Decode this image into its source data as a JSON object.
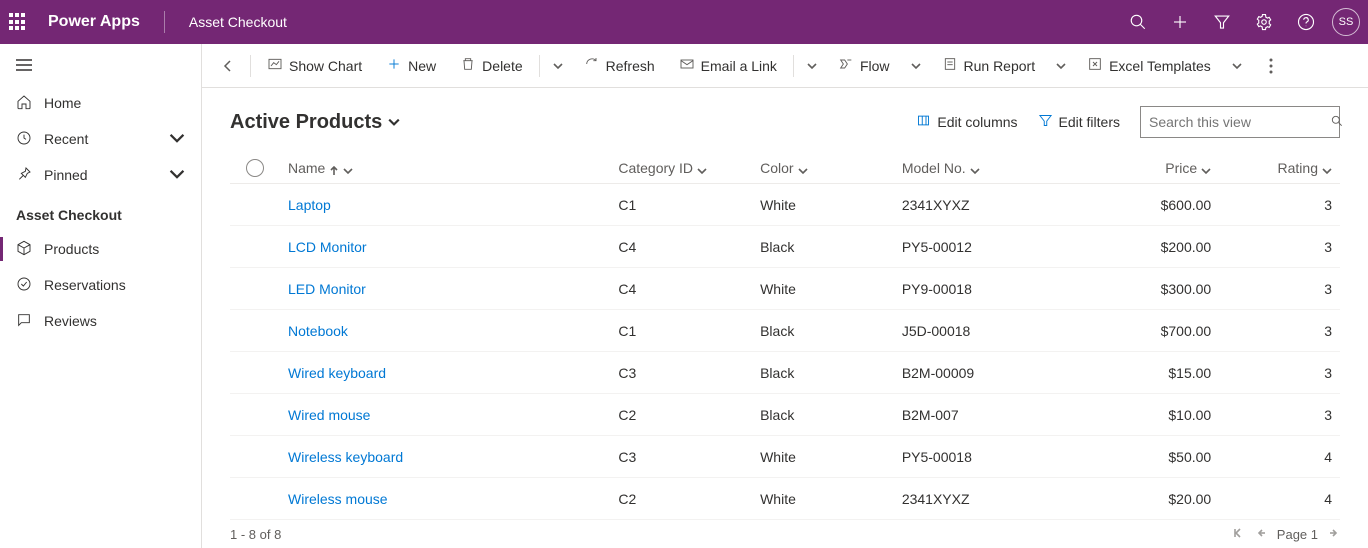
{
  "header": {
    "app_title": "Power Apps",
    "app_subtitle": "Asset Checkout",
    "avatar_initials": "SS"
  },
  "sidebar": {
    "nav": [
      {
        "label": "Home"
      },
      {
        "label": "Recent"
      },
      {
        "label": "Pinned"
      }
    ],
    "section_label": "Asset Checkout",
    "section_items": [
      {
        "label": "Products"
      },
      {
        "label": "Reservations"
      },
      {
        "label": "Reviews"
      }
    ]
  },
  "commandbar": {
    "show_chart": "Show Chart",
    "new": "New",
    "delete": "Delete",
    "refresh": "Refresh",
    "email_link": "Email a Link",
    "flow": "Flow",
    "run_report": "Run Report",
    "excel_templates": "Excel Templates"
  },
  "view": {
    "title": "Active Products",
    "edit_columns": "Edit columns",
    "edit_filters": "Edit filters",
    "search_placeholder": "Search this view"
  },
  "grid": {
    "columns": {
      "name": "Name",
      "category": "Category ID",
      "color": "Color",
      "model": "Model No.",
      "price": "Price",
      "rating": "Rating"
    },
    "rows": [
      {
        "name": "Laptop",
        "category": "C1",
        "color": "White",
        "model": "2341XYXZ",
        "price": "$600.00",
        "rating": "3"
      },
      {
        "name": "LCD Monitor",
        "category": "C4",
        "color": "Black",
        "model": "PY5-00012",
        "price": "$200.00",
        "rating": "3"
      },
      {
        "name": "LED Monitor",
        "category": "C4",
        "color": "White",
        "model": "PY9-00018",
        "price": "$300.00",
        "rating": "3"
      },
      {
        "name": "Notebook",
        "category": "C1",
        "color": "Black",
        "model": "J5D-00018",
        "price": "$700.00",
        "rating": "3"
      },
      {
        "name": "Wired keyboard",
        "category": "C3",
        "color": "Black",
        "model": "B2M-00009",
        "price": "$15.00",
        "rating": "3"
      },
      {
        "name": "Wired mouse",
        "category": "C2",
        "color": "Black",
        "model": "B2M-007",
        "price": "$10.00",
        "rating": "3"
      },
      {
        "name": "Wireless keyboard",
        "category": "C3",
        "color": "White",
        "model": "PY5-00018",
        "price": "$50.00",
        "rating": "4"
      },
      {
        "name": "Wireless mouse",
        "category": "C2",
        "color": "White",
        "model": "2341XYXZ",
        "price": "$20.00",
        "rating": "4"
      }
    ]
  },
  "footer": {
    "range": "1 - 8 of 8",
    "page_label": "Page 1"
  }
}
